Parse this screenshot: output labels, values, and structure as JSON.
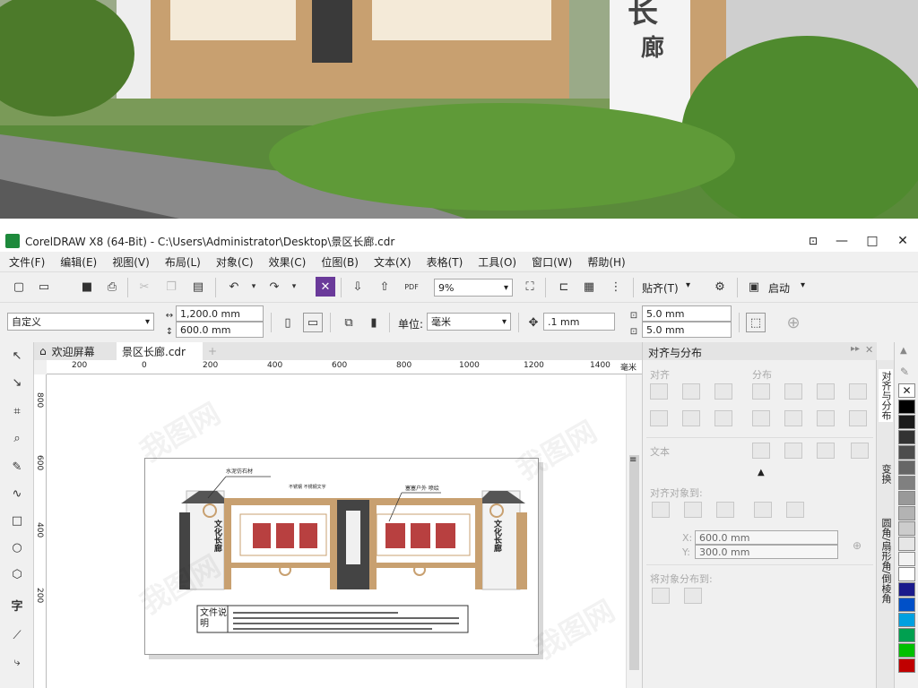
{
  "window": {
    "title": "CorelDRAW X8 (64-Bit) - C:\\Users\\Administrator\\Desktop\\景区长廊.cdr",
    "minimize": "—",
    "restore": "□",
    "close": "✕"
  },
  "menu": [
    "文件(F)",
    "编辑(E)",
    "视图(V)",
    "布局(L)",
    "对象(C)",
    "效果(C)",
    "位图(B)",
    "文本(X)",
    "表格(T)",
    "工具(O)",
    "窗口(W)",
    "帮助(H)"
  ],
  "toolbar": {
    "zoom": "9%",
    "snap_label": "贴齐(T)",
    "launch_label": "启动",
    "pdf_label": "PDF"
  },
  "propbar": {
    "preset": "自定义",
    "width": "1,200.0 mm",
    "height": "600.0 mm",
    "unit_label": "单位:",
    "unit": "毫米",
    "nudge": ".1 mm",
    "dup_x": "5.0 mm",
    "dup_y": "5.0 mm"
  },
  "tabs": {
    "welcome": "欢迎屏幕",
    "document": "景区长廊.cdr",
    "add": "+"
  },
  "ruler": {
    "h_ticks": [
      "200",
      "0",
      "200",
      "400",
      "600",
      "800",
      "1000",
      "1200",
      "1400"
    ],
    "h_unit": "毫米",
    "v_ticks": [
      "800",
      "600",
      "400",
      "200"
    ]
  },
  "artwork": {
    "callout_left": "水泥仿石材",
    "callout_mid": "不锈钢 不锈钢文字",
    "callout_right": "塞塞户外 喷绘",
    "pillar_left": "文化长廊",
    "pillar_right": "文化长廊",
    "notes_label": "文件说明"
  },
  "panel": {
    "title": "对齐与分布",
    "align_label": "对齐",
    "distribute_label": "分布",
    "text_label": "文本",
    "align_to_label": "对齐对象到:",
    "x_value": "600.0 mm",
    "y_value": "300.0 mm",
    "x_label": "X:",
    "y_label": "Y:",
    "distribute_to_label": "将对象分布到:"
  },
  "side_tabs": [
    "对齐与分布",
    "变换",
    "圆角/扇形角/倒棱角"
  ],
  "palette": [
    "#ffffff",
    "#000000",
    "#1a1a1a",
    "#333333",
    "#4d4d4d",
    "#666666",
    "#808080",
    "#999999",
    "#b3b3b3",
    "#cccccc",
    "#e6e6e6",
    "#f2f2f2",
    "#ffffff",
    "#1a1a8c",
    "#0050c8",
    "#00a0e0",
    "#00a050",
    "#00c000",
    "#c00000"
  ],
  "colors": {
    "accent_green": "#1e8a3c",
    "panel_bg": "#f0f0f0",
    "gallery_wood": "#c8a070"
  }
}
